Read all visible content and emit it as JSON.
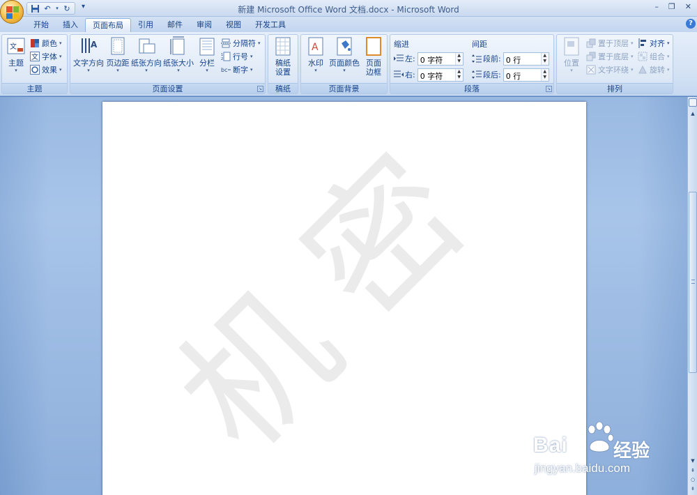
{
  "window": {
    "title": "新建 Microsoft Office Word 文档.docx - Microsoft Word"
  },
  "qat": {
    "more": "▾"
  },
  "tabs": [
    {
      "label": "开始",
      "active": false
    },
    {
      "label": "插入",
      "active": false
    },
    {
      "label": "页面布局",
      "active": true
    },
    {
      "label": "引用",
      "active": false
    },
    {
      "label": "邮件",
      "active": false
    },
    {
      "label": "审阅",
      "active": false
    },
    {
      "label": "视图",
      "active": false
    },
    {
      "label": "开发工具",
      "active": false
    }
  ],
  "ribbon": {
    "theme": {
      "label": "主题",
      "theme_button": "主题",
      "colors": "颜色",
      "fonts": "字体",
      "effects": "效果"
    },
    "page_setup": {
      "label": "页面设置",
      "text_direction": "文字方向",
      "margins": "页边距",
      "orientation": "纸张方向",
      "size": "纸张大小",
      "columns": "分栏",
      "breaks": "分隔符",
      "line_numbers": "行号",
      "hyphenation": "断字"
    },
    "manuscript": {
      "label": "稿纸",
      "settings_line1": "稿纸",
      "settings_line2": "设置"
    },
    "page_background": {
      "label": "页面背景",
      "watermark": "水印",
      "page_color": "页面颜色",
      "borders_line1": "页面",
      "borders_line2": "边框"
    },
    "paragraph": {
      "label": "段落",
      "indent_title": "缩进",
      "indent_left_label": "左:",
      "indent_left_value": "0 字符",
      "indent_right_label": "右:",
      "indent_right_value": "0 字符",
      "spacing_title": "间距",
      "spacing_before_label": "段前:",
      "spacing_before_value": "0 行",
      "spacing_after_label": "段后:",
      "spacing_after_value": "0 行"
    },
    "arrange": {
      "label": "排列",
      "position": "位置",
      "bring_front": "置于顶层",
      "send_back": "置于底层",
      "text_wrap": "文字环绕",
      "align": "对齐",
      "group": "组合",
      "rotate": "旋转"
    }
  },
  "document": {
    "watermark_text": [
      "机",
      "密"
    ]
  },
  "overlay": {
    "brand": "Bai",
    "brand_cn": "经验",
    "url": "jingyan.baidu.com"
  },
  "colors": {
    "ribbon_text": "#15428b",
    "workspace": "#a6c3e8",
    "watermark": "#ebebeb"
  }
}
